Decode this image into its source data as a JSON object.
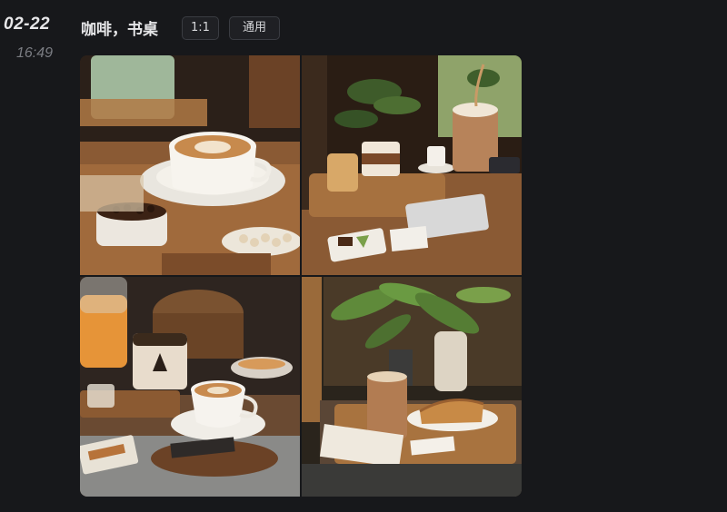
{
  "header": {
    "date": "02-22",
    "time": "16:49",
    "prompt": "咖啡，书桌",
    "tags": {
      "ratio": "1:1",
      "mode": "通用"
    }
  },
  "images": [
    {
      "subject": "latte-art-cup-with-coffee-beans"
    },
    {
      "subject": "coffee-on-wooden-desk-with-keyboard-and-plant"
    },
    {
      "subject": "latte-with-orange-juice-and-jar"
    },
    {
      "subject": "iced-coffee-with-toast-on-tray"
    }
  ]
}
